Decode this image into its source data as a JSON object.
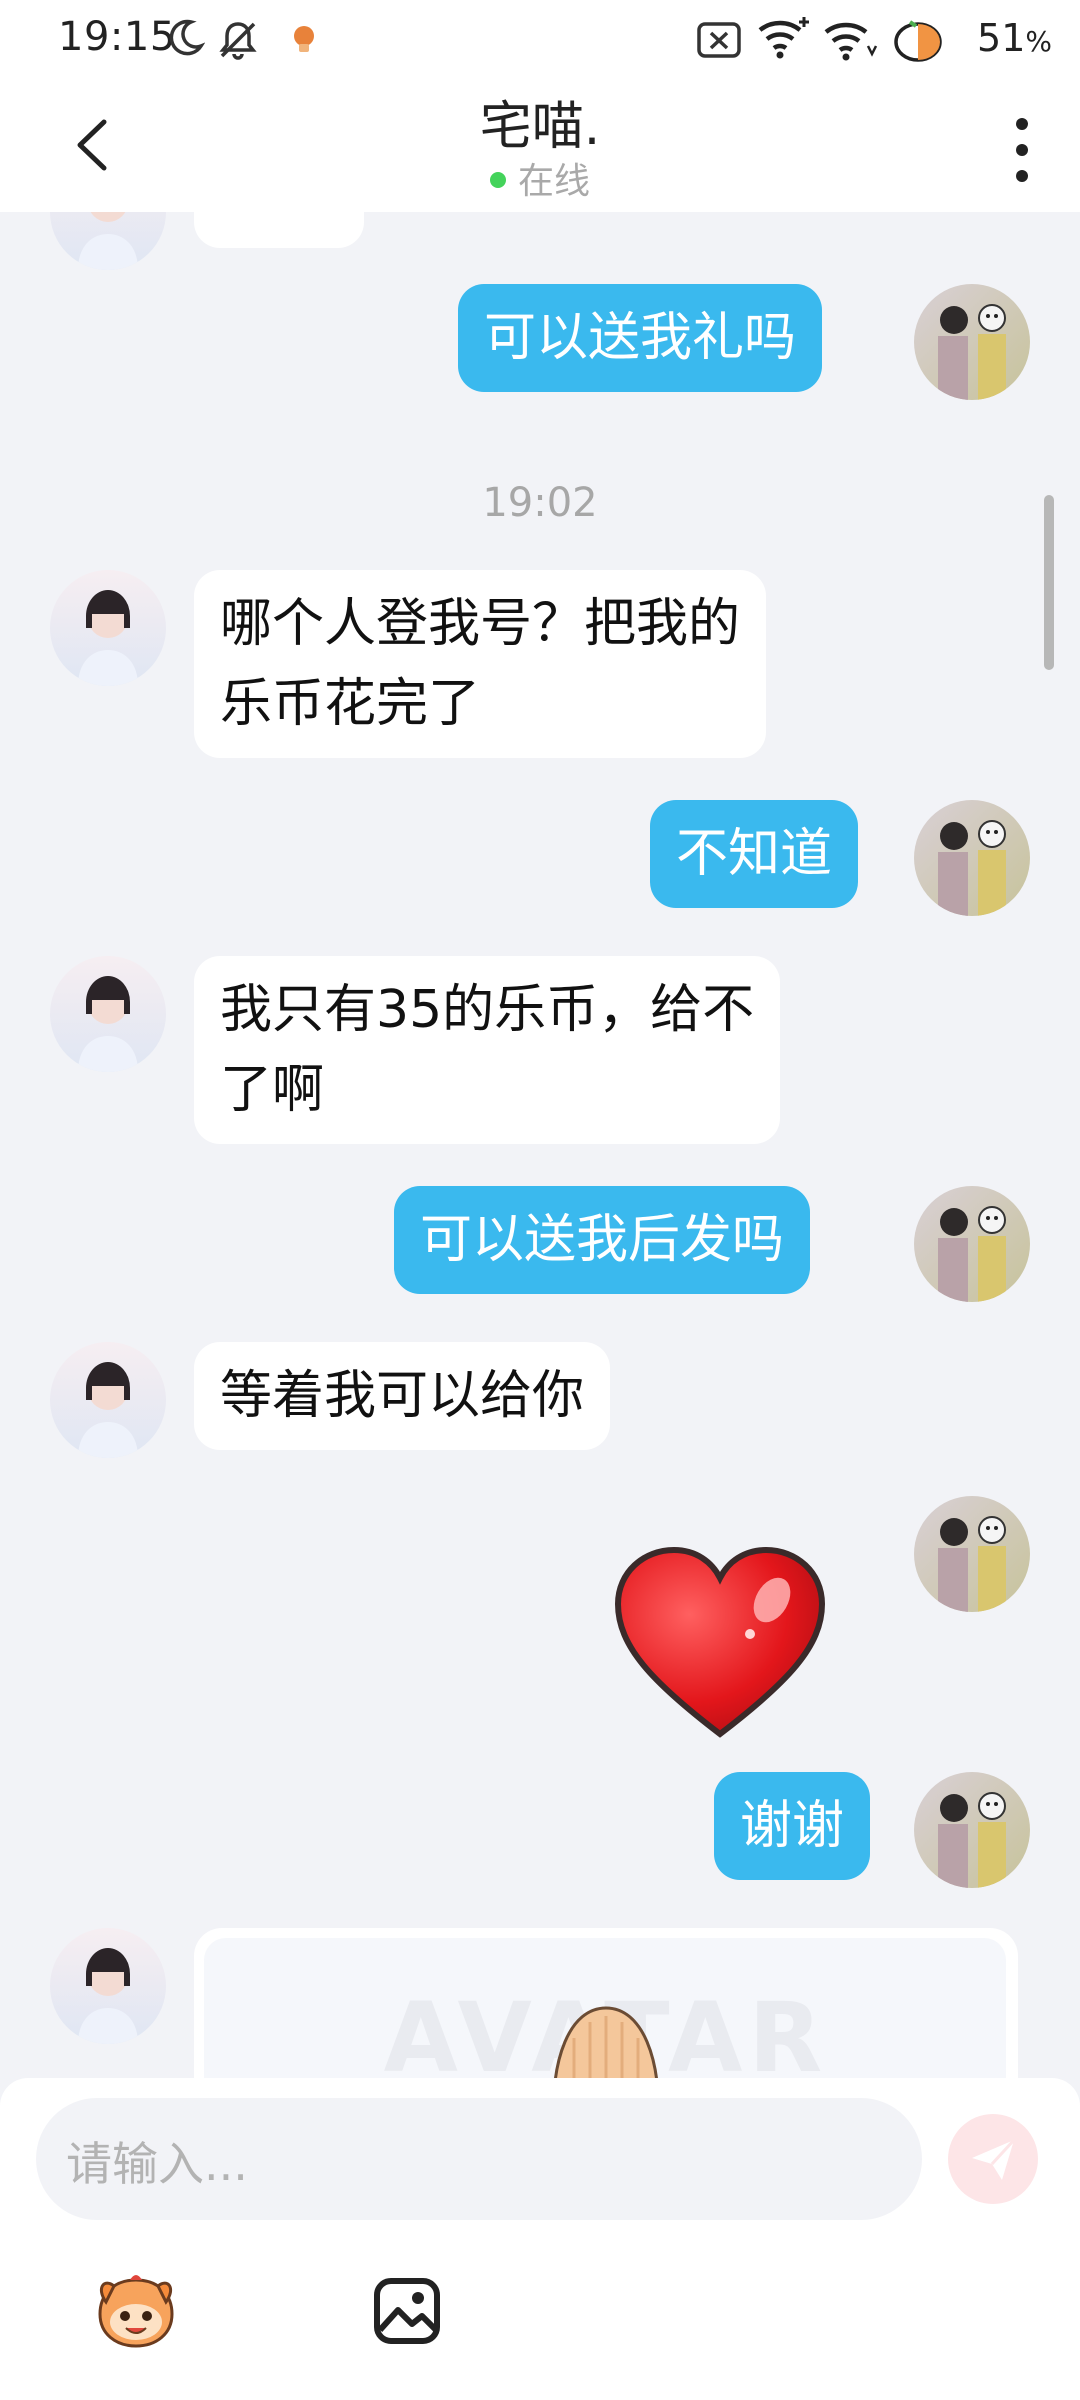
{
  "status_bar": {
    "time": "19:15",
    "battery": "51",
    "battery_unit": "%"
  },
  "header": {
    "contact_name": "宅喵.",
    "status": "在线"
  },
  "chat": {
    "messages": [
      {
        "from": "me",
        "text": "可以送我礼吗"
      },
      {
        "time": "19:02"
      },
      {
        "from": "other",
        "text_line1": "哪个人登我号？把我的",
        "text_line2": "乐币花完了"
      },
      {
        "from": "me",
        "text": "不知道"
      },
      {
        "from": "other",
        "text_line1": "我只有35的乐币，给不",
        "text_line2": "了啊"
      },
      {
        "from": "me",
        "text": "可以送我后发吗"
      },
      {
        "from": "other",
        "text": "等着我可以给你"
      },
      {
        "from": "me",
        "sticker": "heart-sticker"
      },
      {
        "from": "me",
        "text": "谢谢"
      },
      {
        "from": "other",
        "card_watermark": "AVATAR"
      }
    ]
  },
  "composer": {
    "placeholder": "请输入..."
  },
  "colors": {
    "outgoing_bubble": "#3ab9ee",
    "incoming_bubble": "#ffffff",
    "background": "#f2f3f7",
    "online": "#44d35b"
  }
}
